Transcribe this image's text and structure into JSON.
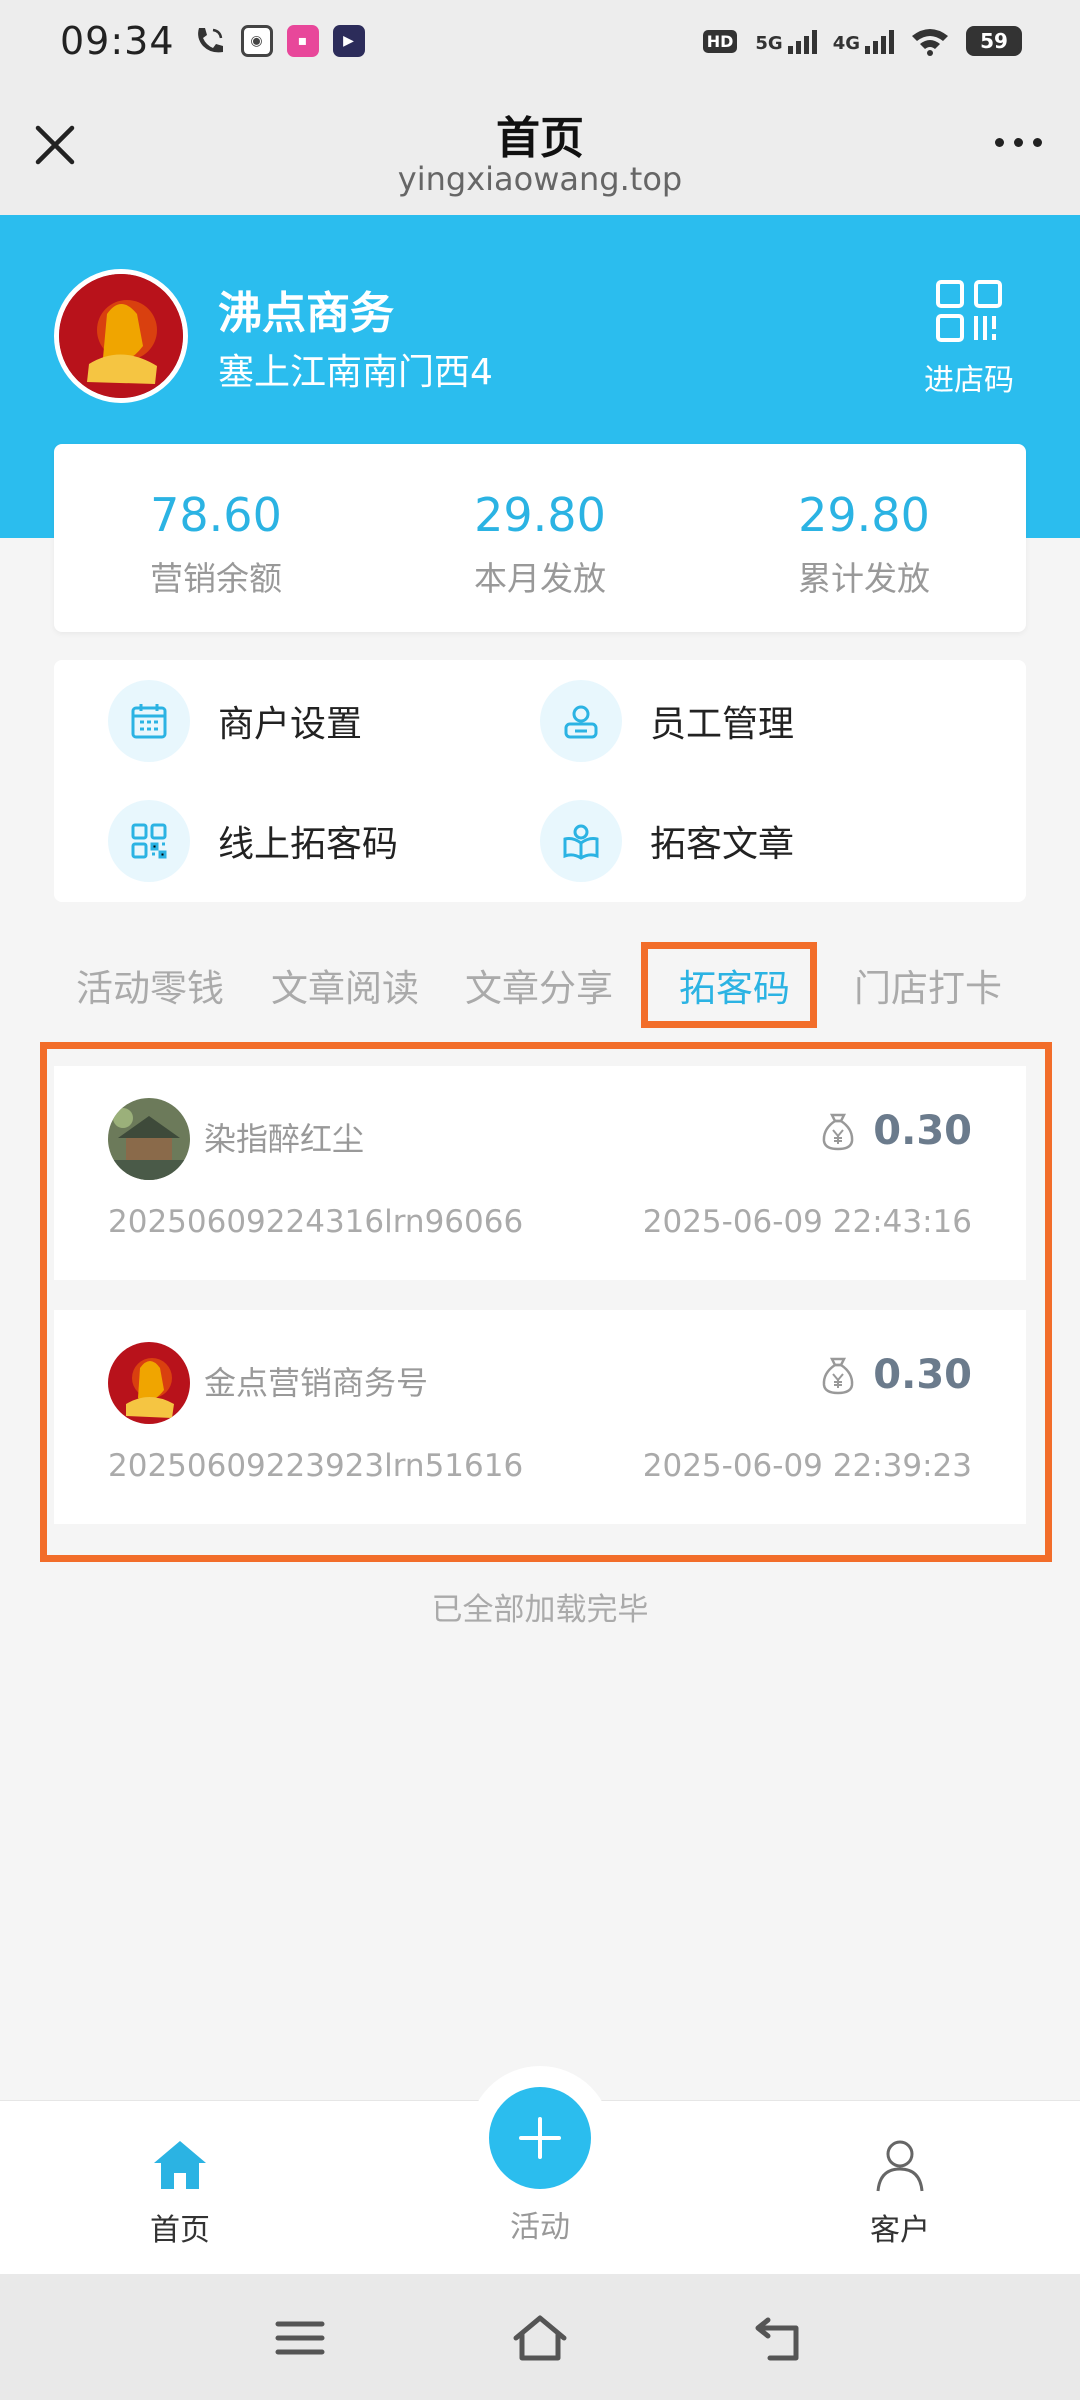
{
  "status_bar": {
    "time": "09:34",
    "network_1": "5G",
    "network_2": "4G",
    "hd": "HD",
    "battery": "59"
  },
  "title_bar": {
    "title": "首页",
    "subtitle": "yingxiaowang.top"
  },
  "shop": {
    "name": "沸点商务",
    "address": "塞上江南南门西4",
    "qr_label": "进店码"
  },
  "stats": [
    {
      "value": "78.60",
      "label": "营销余额"
    },
    {
      "value": "29.80",
      "label": "本月发放"
    },
    {
      "value": "29.80",
      "label": "累计发放"
    }
  ],
  "menu": [
    {
      "label": "商户设置",
      "icon": "calendar-icon"
    },
    {
      "label": "员工管理",
      "icon": "person-card-icon"
    },
    {
      "label": "线上拓客码",
      "icon": "qrcode-icon"
    },
    {
      "label": "拓客文章",
      "icon": "book-icon"
    }
  ],
  "tabs": [
    {
      "label": "活动零钱",
      "active": false
    },
    {
      "label": "文章阅读",
      "active": false
    },
    {
      "label": "文章分享",
      "active": false
    },
    {
      "label": "拓客码",
      "active": true
    },
    {
      "label": "门店打卡",
      "active": false
    }
  ],
  "records": [
    {
      "name": "染指醉红尘",
      "amount": "0.30",
      "order_no": "20250609224316lrn96066",
      "time": "2025-06-09 22:43:16"
    },
    {
      "name": "金点营销商务号",
      "amount": "0.30",
      "order_no": "20250609223923lrn51616",
      "time": "2025-06-09 22:39:23"
    }
  ],
  "list_footer": "已全部加载完毕",
  "bottom_nav": {
    "home": "首页",
    "activity": "活动",
    "customer": "客户"
  },
  "colors": {
    "accent": "#2bbdee",
    "highlight": "#f26d2a"
  }
}
